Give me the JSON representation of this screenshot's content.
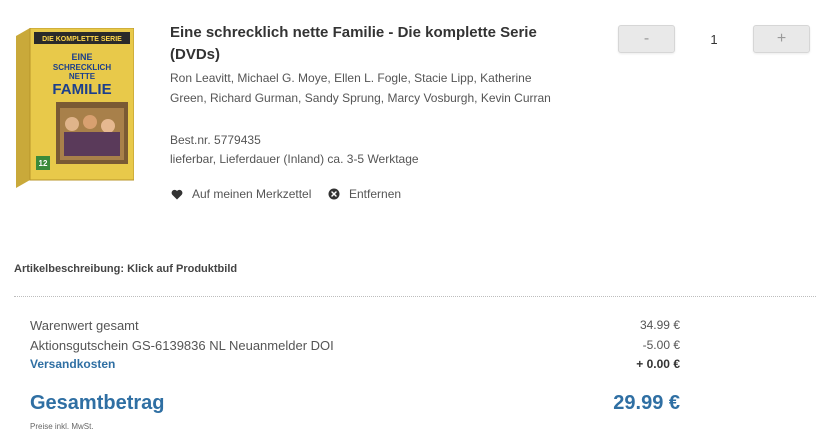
{
  "product": {
    "title": "Eine schrecklich nette Familie - Die komplette Serie (DVDs)",
    "cast": "Ron Leavitt, Michael G. Moye, Ellen L. Fogle, Stacie Lipp, Katherine Green, Richard Gurman, Sandy Sprung, Marcy Vosburgh, Kevin Curran",
    "order_number": "Best.nr. 5779435",
    "availability": "lieferbar, Lieferdauer (Inland) ca. 3-5 Werktage",
    "image": {
      "banner": "DIE KOMPLETTE SERIE",
      "line1": "EINE",
      "line2": "SCHRECKLICH",
      "line3": "NETTE",
      "line4": "FAMILIE",
      "rating": "12"
    }
  },
  "actions": {
    "wishlist_label": "Auf meinen Merkzettel",
    "wishlist_icon": "heart-icon",
    "remove_label": "Entfernen",
    "remove_icon": "close-circle-icon"
  },
  "quantity": {
    "decrement": "-",
    "value": "1",
    "increment": "+"
  },
  "description_hint": "Artikelbeschreibung: Klick auf Produktbild",
  "summary": {
    "goods_label": "Warenwert gesamt",
    "goods_value": "34.99 €",
    "voucher_label": "Aktionsgutschein GS-6139836 NL Neuanmelder DOI",
    "voucher_value": "-5.00 €",
    "shipping_label": "Versandkosten",
    "shipping_value": "+ 0.00 €",
    "total_label": "Gesamtbetrag",
    "total_value": "29.99 €",
    "vat_note": "Preise inkl. MwSt."
  },
  "colors": {
    "accent": "#2f6fa3",
    "box_yellow": "#e8c94a",
    "box_dark": "#6b5a2a"
  }
}
